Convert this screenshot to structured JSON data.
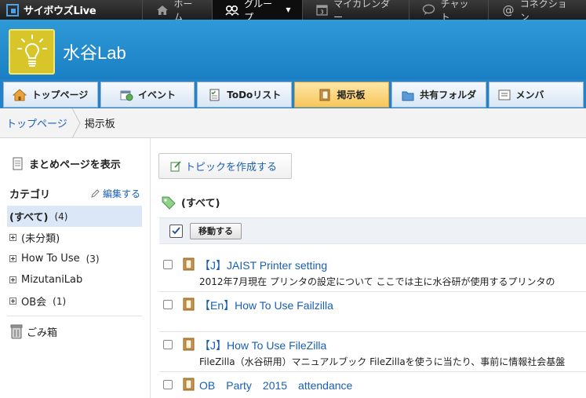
{
  "app": {
    "brand": "サイボウズLive"
  },
  "topnav": {
    "items": [
      {
        "label": "ホーム",
        "icon": "home-icon",
        "active": false
      },
      {
        "label": "グループ",
        "icon": "group-icon",
        "active": true
      },
      {
        "label": "マイカレンダー",
        "icon": "calendar-icon",
        "active": false,
        "icon_text": "3"
      },
      {
        "label": "チャット",
        "icon": "chat-icon",
        "active": false
      },
      {
        "label": "コネクション",
        "icon": "at-icon",
        "active": false
      }
    ]
  },
  "group": {
    "title": "水谷Lab"
  },
  "tabs": [
    {
      "label": "トップページ",
      "icon": "home-icon",
      "active": false
    },
    {
      "label": "イベント",
      "icon": "event-icon",
      "active": false
    },
    {
      "label": "ToDoリスト",
      "icon": "todo-icon",
      "active": false
    },
    {
      "label": "掲示板",
      "icon": "board-icon",
      "active": true
    },
    {
      "label": "共有フォルダ",
      "icon": "folder-icon",
      "active": false
    },
    {
      "label": "メンバ",
      "icon": "member-icon",
      "active": false
    }
  ],
  "breadcrumb": {
    "home": "トップページ",
    "current": "掲示板"
  },
  "sidebar": {
    "summary_label": "まとめページを表示",
    "category_heading": "カテゴリ",
    "edit_label": "編集する",
    "categories": [
      {
        "label": "(すべて)",
        "count": "(4)",
        "selected": true,
        "expandable": false
      },
      {
        "label": "(未分類)",
        "count": "",
        "selected": false,
        "expandable": true
      },
      {
        "label": "How To Use",
        "count": "(3)",
        "selected": false,
        "expandable": true
      },
      {
        "label": "MizutaniLab",
        "count": "",
        "selected": false,
        "expandable": true
      },
      {
        "label": "OB会",
        "count": "(1)",
        "selected": false,
        "expandable": true
      }
    ],
    "trash_label": "ごみ箱"
  },
  "main": {
    "create_label": "トピックを作成する",
    "filter_heading": "(すべて)",
    "move_label": "移動する",
    "topics": [
      {
        "title": "【J】JAIST Printer setting",
        "summary": "2012年7月現在 プリンタの設定について ここでは主に水谷研が使用するプリンタの"
      },
      {
        "title": "【En】How To Use Failzilla",
        "summary": ""
      },
      {
        "title": "【J】How To Use FileZilla",
        "summary": "FileZilla（水谷研用）マニュアルブック FileZillaを使うに当たり、事前に情報社会基盤"
      },
      {
        "title": "OB　Party　2015　attendance",
        "summary": ""
      }
    ]
  },
  "colors": {
    "accent_blue": "#1f86cc",
    "link": "#1a5fb4",
    "active_tab": "#f8c65a",
    "topbar": "#262626"
  }
}
